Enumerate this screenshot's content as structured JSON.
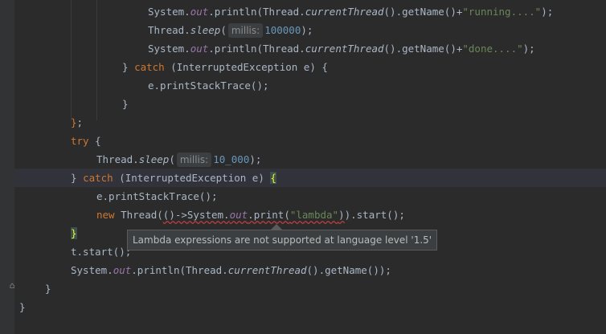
{
  "editor": {
    "lines": [
      {
        "indent": 184,
        "parts": [
          [
            "",
            "System."
          ],
          [
            "field",
            "out"
          ],
          [
            "",
            ".println(Thread."
          ],
          [
            "static",
            "currentThread"
          ],
          [
            "",
            "().getName()+"
          ],
          [
            "str",
            "\"running....\""
          ],
          [
            "",
            ");"
          ]
        ]
      },
      {
        "indent": 184,
        "parts": [
          [
            "",
            "Thread."
          ],
          [
            "static",
            "sleep"
          ],
          [
            "",
            "("
          ],
          [
            "hint",
            "millis:"
          ],
          [
            "num",
            "100000"
          ],
          [
            "",
            ");"
          ]
        ]
      },
      {
        "indent": 184,
        "parts": [
          [
            "",
            "System."
          ],
          [
            "field",
            "out"
          ],
          [
            "",
            ".println(Thread."
          ],
          [
            "static",
            "currentThread"
          ],
          [
            "",
            "().getName()+"
          ],
          [
            "str",
            "\"done....\""
          ],
          [
            "",
            ");"
          ]
        ]
      },
      {
        "indent": 152,
        "parts": [
          [
            "",
            "} "
          ],
          [
            "kw",
            "catch"
          ],
          [
            "",
            " (InterruptedException e) {"
          ]
        ]
      },
      {
        "indent": 184,
        "parts": [
          [
            "",
            "e.printStackTrace();"
          ]
        ]
      },
      {
        "indent": 152,
        "parts": [
          [
            "",
            "}"
          ]
        ]
      },
      {
        "indent": 88,
        "parts": [
          [
            "kw",
            "}"
          ],
          [
            "",
            ";"
          ]
        ]
      },
      {
        "indent": 88,
        "parts": [
          [
            "kw",
            "try"
          ],
          [
            "",
            " {"
          ]
        ]
      },
      {
        "indent": 120,
        "parts": [
          [
            "",
            "Thread."
          ],
          [
            "static",
            "sleep"
          ],
          [
            "",
            "("
          ],
          [
            "hint",
            "millis:"
          ],
          [
            "num",
            "10_000"
          ],
          [
            "",
            ");"
          ]
        ]
      },
      {
        "indent": 88,
        "parts": [
          [
            "",
            "} "
          ],
          [
            "kw",
            "catch"
          ],
          [
            "",
            " (InterruptedException e) "
          ],
          [
            "brace",
            "{"
          ]
        ]
      },
      {
        "indent": 120,
        "parts": [
          [
            "",
            "e.printStackTrace();"
          ]
        ]
      },
      {
        "indent": 120,
        "parts": [
          [
            "kw",
            "new"
          ],
          [
            "",
            " Thread("
          ],
          [
            "err",
            "()->System."
          ],
          [
            "errfield",
            "out"
          ],
          [
            "err",
            ".print("
          ],
          [
            "errstr",
            "\"lambda\""
          ],
          [
            "err",
            ")"
          ],
          [
            "",
            ").start();"
          ]
        ]
      },
      {
        "indent": 88,
        "parts": [
          [
            "brace",
            "}"
          ]
        ]
      },
      {
        "indent": 88,
        "parts": [
          [
            "",
            "t.start();"
          ]
        ]
      },
      {
        "indent": 88,
        "parts": [
          [
            "",
            "System."
          ],
          [
            "field",
            "out"
          ],
          [
            "",
            ".println(Thread."
          ],
          [
            "static",
            "currentThread"
          ],
          [
            "",
            "().getName());"
          ]
        ]
      },
      {
        "indent": 56,
        "parts": [
          [
            "",
            "}"
          ]
        ]
      },
      {
        "indent": 24,
        "parts": [
          [
            "",
            "}"
          ]
        ]
      }
    ]
  },
  "tooltip": {
    "text": "Lambda expressions are not supported at language level '1.5'"
  }
}
